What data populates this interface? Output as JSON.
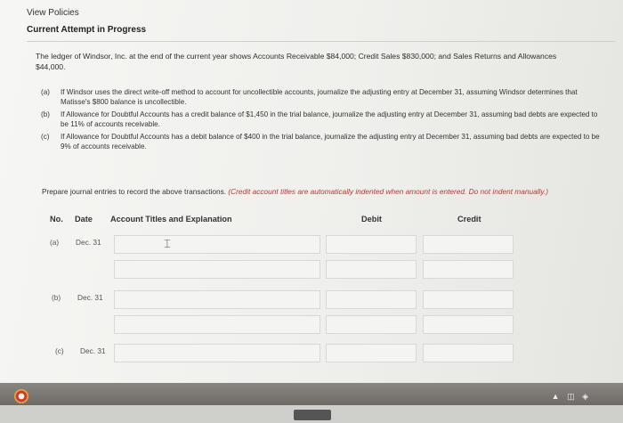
{
  "header": {
    "view_policies": "View Policies",
    "attempt_status": "Current Attempt in Progress"
  },
  "problem": {
    "intro": "The ledger of Windsor, Inc. at the end of the current year shows Accounts Receivable $84,000; Credit Sales $830,000; and Sales Returns and Allowances $44,000.",
    "parts": [
      {
        "label": "(a)",
        "text": "If Windsor uses the direct write-off method to account for uncollectible accounts, journalize the adjusting entry at December 31, assuming Windsor determines that Matisse's $800 balance is uncollectible."
      },
      {
        "label": "(b)",
        "text": "If Allowance for Doubtful Accounts has a credit balance of $1,450 in the trial balance, journalize the adjusting entry at December 31, assuming bad debts are expected to be 11% of accounts receivable."
      },
      {
        "label": "(c)",
        "text": "If Allowance for Doubtful Accounts has a debit balance of $400 in the trial balance, journalize the adjusting entry at December 31, assuming bad debts are expected to be 9% of accounts receivable."
      }
    ],
    "instruction": "Prepare journal entries to record the above transactions.",
    "instruction_note": "(Credit account titles are automatically indented when amount is entered. Do not indent manually.)"
  },
  "table": {
    "headers": {
      "no": "No.",
      "date": "Date",
      "account": "Account Titles and Explanation",
      "debit": "Debit",
      "credit": "Credit"
    },
    "rows": [
      {
        "no": "(a)",
        "date": "Dec. 31"
      },
      {
        "no": "(b)",
        "date": "Dec. 31"
      },
      {
        "no": "(c)",
        "date": "Dec. 31"
      }
    ]
  },
  "icons": [
    "browser-icon",
    "text-cursor-icon"
  ]
}
